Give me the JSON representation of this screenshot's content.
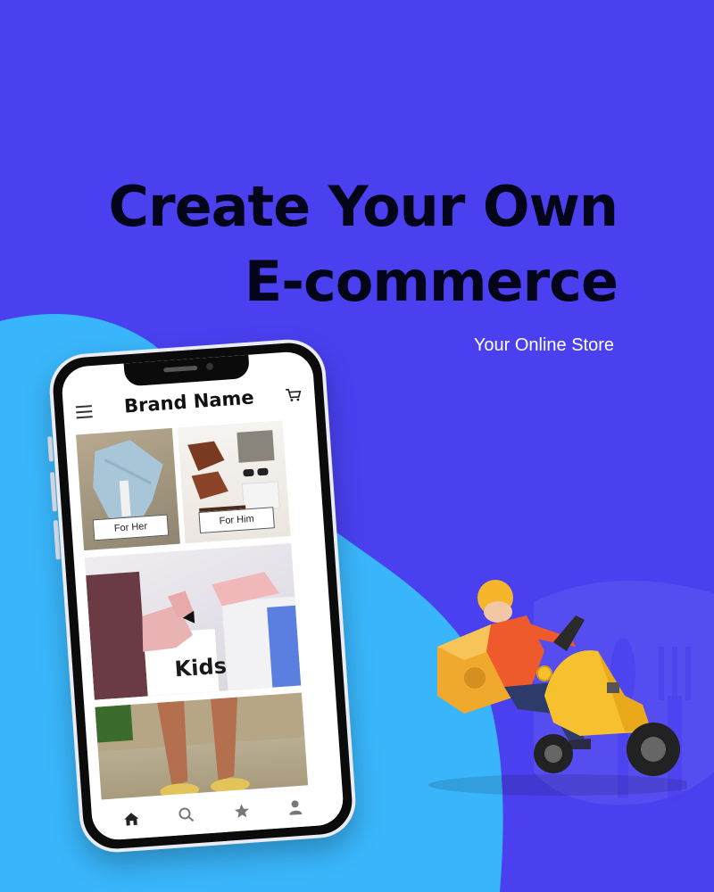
{
  "headline": {
    "line1": "Create Your Own",
    "line2": "E-commerce"
  },
  "subline": "Your Online Store",
  "phone": {
    "app": {
      "brand_name": "Brand Name",
      "icons": {
        "menu": "menu-icon",
        "cart": "cart-icon"
      },
      "tiles": [
        {
          "label": "For Her"
        },
        {
          "label": "For Him"
        },
        {
          "label": "Kids"
        },
        {
          "label": ""
        }
      ],
      "bottom_nav": [
        "home-icon",
        "search-icon",
        "star-icon",
        "user-icon"
      ]
    }
  },
  "colors": {
    "background": "#4a40ef",
    "blob": "#39b6fb",
    "headline": "#05051a",
    "subline": "#ffffff",
    "scooter": "#f6c02e",
    "shirt": "#ef5a2d"
  }
}
